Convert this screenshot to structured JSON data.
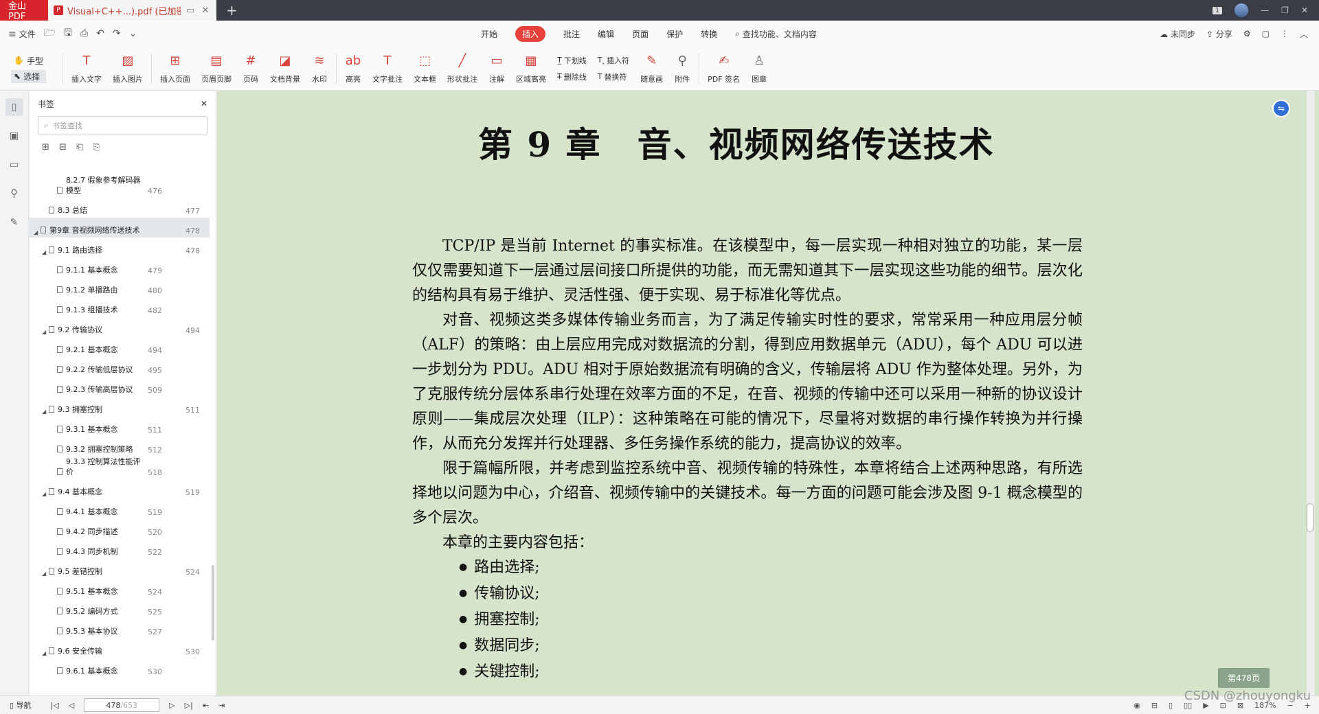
{
  "titlebar": {
    "app_name": "金山PDF",
    "doc_tab": "Visual+C++...).pdf (已加密)",
    "page_count_badge": "1"
  },
  "menubar": {
    "file_label": "文件",
    "tabs": [
      "开始",
      "插入",
      "批注",
      "编辑",
      "页面",
      "保护",
      "转换"
    ],
    "active_tab": "插入",
    "search_label": "查找功能、文档内容",
    "sync_label": "未同步",
    "share_label": "分享"
  },
  "ribbon": {
    "hand_label": "手型",
    "select_label": "选择",
    "tools": [
      {
        "label": "插入文字",
        "icon": "text-insert-icon"
      },
      {
        "label": "插入图片",
        "icon": "image-icon"
      },
      {
        "label": "插入页面",
        "icon": "page-add-icon"
      },
      {
        "label": "页眉页脚",
        "icon": "header-footer-icon"
      },
      {
        "label": "页码",
        "icon": "page-number-icon"
      },
      {
        "label": "文档背景",
        "icon": "background-icon"
      },
      {
        "label": "水印",
        "icon": "watermark-icon"
      },
      {
        "label": "高亮",
        "icon": "highlight-icon"
      },
      {
        "label": "文字批注",
        "icon": "text-comment-icon"
      },
      {
        "label": "文本框",
        "icon": "textbox-icon"
      },
      {
        "label": "形状批注",
        "icon": "shape-icon"
      },
      {
        "label": "注解",
        "icon": "note-icon"
      },
      {
        "label": "区域高亮",
        "icon": "area-highlight-icon"
      }
    ],
    "stack1": [
      "下划线",
      "删除线"
    ],
    "stack2": [
      "插入符",
      "替换符"
    ],
    "tools2": [
      {
        "label": "随意画",
        "icon": "pen-icon"
      },
      {
        "label": "附件",
        "icon": "attachment-icon"
      },
      {
        "label": "PDF 签名",
        "icon": "signature-icon"
      },
      {
        "label": "图章",
        "icon": "stamp-icon"
      }
    ]
  },
  "bookmarks": {
    "title": "书签",
    "search_placeholder": "书签查找",
    "items": [
      {
        "label": "8.2.7 假象参考解码器模型",
        "page": "476",
        "level": 3
      },
      {
        "label": "8.3 总结",
        "page": "477",
        "level": 2
      },
      {
        "label": "第9章 音视频网络传送技术",
        "page": "478",
        "level": 1,
        "selected": true,
        "expanded": true
      },
      {
        "label": "9.1 路由选择",
        "page": "478",
        "level": 2,
        "expanded": true
      },
      {
        "label": "9.1.1 基本概念",
        "page": "479",
        "level": 3
      },
      {
        "label": "9.1.2 单播路由",
        "page": "480",
        "level": 3
      },
      {
        "label": "9.1.3 组播技术",
        "page": "482",
        "level": 3
      },
      {
        "label": "9.2 传输协议",
        "page": "494",
        "level": 2,
        "expanded": true
      },
      {
        "label": "9.2.1 基本概念",
        "page": "494",
        "level": 3
      },
      {
        "label": "9.2.2 传输低层协议",
        "page": "495",
        "level": 3
      },
      {
        "label": "9.2.3 传输高层协议",
        "page": "509",
        "level": 3
      },
      {
        "label": "9.3 拥塞控制",
        "page": "511",
        "level": 2,
        "expanded": true
      },
      {
        "label": "9.3.1 基本概念",
        "page": "511",
        "level": 3
      },
      {
        "label": "9.3.2 拥塞控制策略",
        "page": "512",
        "level": 3
      },
      {
        "label": "9.3.3 控制算法性能评价",
        "page": "518",
        "level": 3
      },
      {
        "label": "9.4 基本概念",
        "page": "519",
        "level": 2,
        "expanded": true
      },
      {
        "label": "9.4.1 基本概念",
        "page": "519",
        "level": 3
      },
      {
        "label": "9.4.2 同步描述",
        "page": "520",
        "level": 3
      },
      {
        "label": "9.4.3 同步机制",
        "page": "522",
        "level": 3
      },
      {
        "label": "9.5 差错控制",
        "page": "524",
        "level": 2,
        "expanded": true
      },
      {
        "label": "9.5.1 基本概念",
        "page": "524",
        "level": 3
      },
      {
        "label": "9.5.2 编码方式",
        "page": "525",
        "level": 3
      },
      {
        "label": "9.5.3 基本协议",
        "page": "527",
        "level": 3
      },
      {
        "label": "9.6 安全传输",
        "page": "530",
        "level": 2,
        "expanded": true
      },
      {
        "label": "9.6.1 基本概念",
        "page": "530",
        "level": 3
      }
    ]
  },
  "document": {
    "chapter_title": "第 9 章　音、视频网络传送技术",
    "paragraphs": [
      "TCP/IP 是当前 Internet 的事实标准。在该模型中，每一层实现一种相对独立的功能，某一层仅仅需要知道下一层通过层间接口所提供的功能，而无需知道其下一层实现这些功能的细节。层次化的结构具有易于维护、灵活性强、便于实现、易于标准化等优点。",
      "对音、视频这类多媒体传输业务而言，为了满足传输实时性的要求，常常采用一种应用层分帧（ALF）的策略：由上层应用完成对数据流的分割，得到应用数据单元（ADU），每个 ADU 可以进一步划分为 PDU。ADU 相对于原始数据流有明确的含义，传输层将 ADU 作为整体处理。另外，为了克服传统分层体系串行处理在效率方面的不足，在音、视频的传输中还可以采用一种新的协议设计原则——集成层次处理（ILP）：这种策略在可能的情况下，尽量将对数据的串行操作转换为并行操作，从而充分发挥并行处理器、多任务操作系统的能力，提高协议的效率。",
      "限于篇幅所限，并考虑到监控系统中音、视频传输的特殊性，本章将结合上述两种思路，有所选择地以问题为中心，介绍音、视频传输中的关键技术。每一方面的问题可能会涉及图 9-1 概念模型的多个层次。",
      "本章的主要内容包括："
    ],
    "list_items": [
      "路由选择;",
      "传输协议;",
      "拥塞控制;",
      "数据同步;",
      "关键控制;"
    ]
  },
  "page_indicator": "第478页",
  "statusbar": {
    "nav_label": "导航",
    "current_page": "478",
    "total_pages": "/653",
    "zoom": "187%"
  },
  "watermark": "CSDN @zhouyongku"
}
